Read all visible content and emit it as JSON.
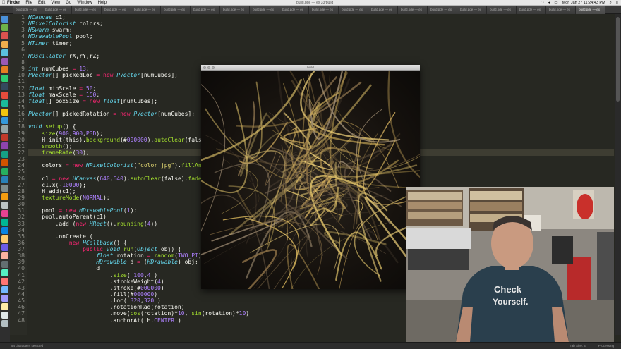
{
  "menubar": {
    "app": "Finder",
    "items": [
      "File",
      "Edit",
      "View",
      "Go",
      "Window",
      "Help"
    ],
    "window_title": "build.pde — ex 33/build",
    "clock": "Mon Jan 27  11:24:43 PM"
  },
  "tabs": [
    "build.pde — ex",
    "build.pde — ex",
    "build.pde — ex",
    "build.pde — ex",
    "build.pde — ex",
    "build.pde — ex",
    "build.pde — ex",
    "build.pde — ex",
    "build.pde — ex",
    "build.pde — ex",
    "build.pde — ex",
    "build.pde — ex",
    "build.pde — ex",
    "build.pde — ex",
    "build.pde — ex",
    "build.pde — ex",
    "build.pde — ex",
    "build.pde — ex",
    "build.pde — ex",
    "build.pde — ex"
  ],
  "active_tab_index": 19,
  "line_numbers": [
    "1",
    "2",
    "3",
    "4",
    "5",
    "6",
    "7",
    "8",
    "9",
    "10",
    "11",
    "12",
    "13",
    "14",
    "15",
    "16",
    "17",
    "18",
    "19",
    "20",
    "21",
    "22",
    "23",
    "24",
    "25",
    "26",
    "27",
    "28",
    "29",
    "30",
    "31",
    "32",
    "33",
    "34",
    "35",
    "36",
    "37",
    "38",
    "39",
    "40",
    "41",
    "42",
    "43",
    "44",
    "45",
    "46",
    "47",
    "48"
  ],
  "code": [
    "HCanvas c1;",
    "HPixelColorist colors;",
    "HSwarm swarm;",
    "HDrawablePool pool;",
    "HTimer timer;",
    "",
    "HOscillator rX,rY,rZ;",
    "",
    "int numCubes = 13;",
    "PVector[] pickedLoc = new PVector[numCubes];",
    "",
    "float minScale = 50;",
    "float maxScale = 150;",
    "float[] boxSize = new float[numCubes];",
    "",
    "PVector[] pickedRotation = new PVector[numCubes];",
    "",
    "void setup() {",
    "    size(900,900,P3D);",
    "    H.init(this).background(#000000).autoClear(false);",
    "    smooth();",
    "    frameRate(30);",
    "",
    "    colors = new HPixelColorist(\"color.jpg\").fillAndStroke();",
    "",
    "    c1 = new HCanvas(640,640).autoClear(false).fade(1);",
    "    c1.x(-10000);",
    "    H.add(c1);",
    "    textureMode(NORMAL);",
    "",
    "    pool = new HDrawablePool(1);",
    "    pool.autoParent(c1)",
    "        .add (new HRect().rounding(4))",
    "",
    "        .onCreate (",
    "            new HCallback() {",
    "                public void run(Object obj) {",
    "                    float rotation = random(TWO_PI);",
    "                    HDrawable d = (HDrawable) obj;",
    "                    d",
    "                        .size( 100,4 )",
    "                        .strokeWeight(4)",
    "                        .stroke(#000000)",
    "                        .fill(#000000)",
    "                        .loc( 320,320 )",
    "                        .rotationRad(rotation)",
    "                        .move(cos(rotation)*10, sin(rotation)*10)",
    "                        .anchorAt( H.CENTER )"
  ],
  "highlighted_line": 21,
  "sketch_window": {
    "title": "build"
  },
  "statusbar": {
    "left": "54 characters selected",
    "tab_size": "Tab Size: 4",
    "language": "Processing"
  },
  "webcam": {
    "shirt_text_line1": "Check",
    "shirt_text_line2": "Yourself."
  },
  "colors": {
    "editor_bg": "#272822",
    "keyword": "#f92672",
    "type": "#66d9ef",
    "number": "#ae81ff",
    "string": "#e6db74",
    "function": "#a6e22e"
  }
}
